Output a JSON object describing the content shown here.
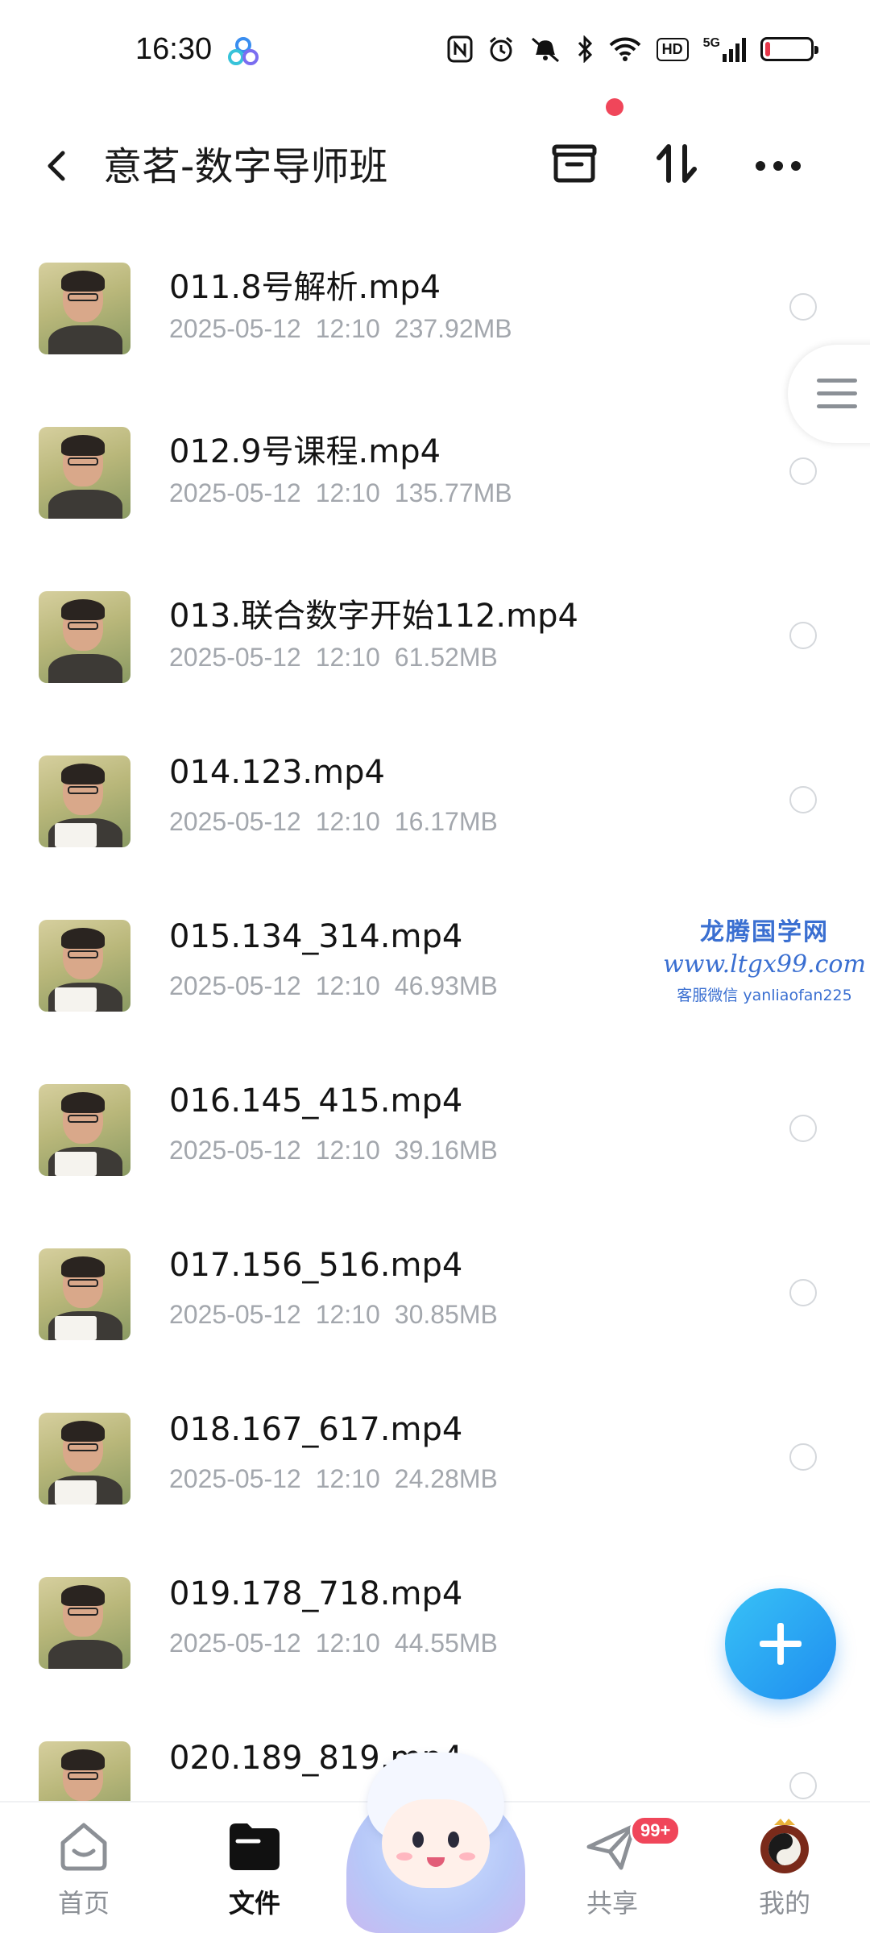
{
  "status_bar": {
    "time": "16:30",
    "network": "5G",
    "hd": "HD",
    "battery_level": 0.12,
    "icons": [
      "app-cloud-icon",
      "nfc-icon",
      "alarm-icon",
      "mute-icon",
      "bluetooth-icon",
      "wifi-icon",
      "hd-icon",
      "signal-5g-icon",
      "battery-icon"
    ]
  },
  "app_bar": {
    "title": "意茗-数字导师班",
    "actions": [
      "transfer-list-icon",
      "sort-icon",
      "more-icon"
    ],
    "has_notification_dot": true
  },
  "files": [
    {
      "name": "011.8号解析.mp4",
      "date": "2025-05-12",
      "time": "12:10",
      "size": "237.92MB"
    },
    {
      "name": "012.9号课程.mp4",
      "date": "2025-05-12",
      "time": "12:10",
      "size": "135.77MB"
    },
    {
      "name": "013.联合数字开始112.mp4",
      "date": "2025-05-12",
      "time": "12:10",
      "size": "61.52MB"
    },
    {
      "name": "014.123.mp4",
      "date": "2025-05-12",
      "time": "12:10",
      "size": "16.17MB"
    },
    {
      "name": "015.134_314.mp4",
      "date": "2025-05-12",
      "time": "12:10",
      "size": "46.93MB"
    },
    {
      "name": "016.145_415.mp4",
      "date": "2025-05-12",
      "time": "12:10",
      "size": "39.16MB"
    },
    {
      "name": "017.156_516.mp4",
      "date": "2025-05-12",
      "time": "12:10",
      "size": "30.85MB"
    },
    {
      "name": "018.167_617.mp4",
      "date": "2025-05-12",
      "time": "12:10",
      "size": "24.28MB"
    },
    {
      "name": "019.178_718.mp4",
      "date": "2025-05-12",
      "time": "12:10",
      "size": "44.55MB"
    },
    {
      "name": "020.189_819.mp4",
      "date": "",
      "time": "",
      "size": ""
    }
  ],
  "watermark": {
    "title": "龙腾国学网",
    "url": "www.ltgx99.com",
    "contact": "客服微信 yanliaofan225"
  },
  "fab": {
    "icon": "plus-icon"
  },
  "bottom_nav": {
    "items": [
      {
        "label": "首页",
        "icon": "home-icon",
        "active": false
      },
      {
        "label": "文件",
        "icon": "folder-icon",
        "active": true
      },
      {
        "label": "共享",
        "icon": "share-paper-plane-icon",
        "active": false,
        "badge": "99+"
      },
      {
        "label": "我的",
        "icon": "profile-avatar-icon",
        "active": false
      }
    ]
  },
  "colors": {
    "accent": "#1f8df0",
    "badge": "#f0465a",
    "meta_text": "#a3a7ad",
    "watermark": "#3a6fd1"
  }
}
